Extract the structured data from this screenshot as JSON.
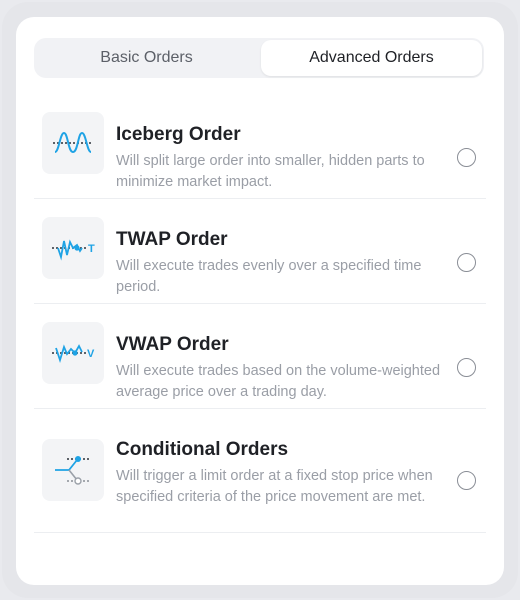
{
  "tabs": [
    {
      "label": "Basic Orders",
      "active": false
    },
    {
      "label": "Advanced Orders",
      "active": true
    }
  ],
  "orders": [
    {
      "title": "Iceberg Order",
      "description": "Will split large order into smaller, hidden parts to minimize market impact.",
      "icon": "iceberg-wave-icon",
      "selected": false
    },
    {
      "title": "TWAP Order",
      "description": "Will execute trades evenly over a specified time period.",
      "icon": "twap-chart-icon",
      "selected": false
    },
    {
      "title": "VWAP Order",
      "description": "Will execute trades based on the volume-weighted average price over a trading day.",
      "icon": "vwap-chart-icon",
      "selected": false
    },
    {
      "title": "Conditional Orders",
      "description": "Will trigger a limit order at a fixed stop price when specified criteria of the price movement are met.",
      "icon": "conditional-branch-icon",
      "selected": false
    }
  ],
  "colors": {
    "accent": "#1fa3e5",
    "dash": "#2b3038"
  }
}
